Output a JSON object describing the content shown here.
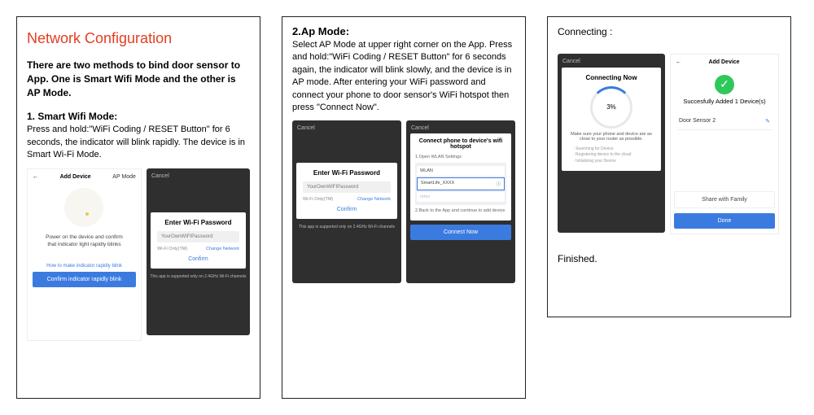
{
  "panel1": {
    "title": "Network Configuration",
    "intro": "There are two methods to bind door sensor to App. One is Smart Wifi Mode and the other is AP Mode.",
    "h": "1. Smart Wifi Mode:",
    "body": "Press and hold:\"WiFi Coding / RESET Button\" for 6 seconds, the indicator will blink rapidly. The device is in Smart Wi-Fi Mode.",
    "phoneA": {
      "back": "←",
      "add": "Add Device",
      "ap": "AP Mode",
      "power": "Power on the device and confirm",
      "blink": "that indicator light rapidly blinks",
      "how": "How to make indicator rapidly blink",
      "confirm": "Confirm indicator rapidly blink"
    },
    "phoneB": {
      "cancel": "Cancel",
      "title": "Enter Wi-Fi Password",
      "input": "YourOwnWIFIPassword",
      "only": "Wi-Fi Only(TM)",
      "change": "Change Network",
      "confirm": "Confirm",
      "note": "This app is supported only on 2.4GHz Wi-Fi channels"
    }
  },
  "panel2": {
    "h": "2.Ap Mode:",
    "body": "Select AP Mode at upper right corner on the App. Press and hold:\"WiFi Coding / RESET Button\" for 6 seconds again, the indicator will blink slowly, and the device is in AP mode. After entering your WiFi password and connect your phone to door sensor's WiFi hotspot then press \"Connect Now\".",
    "phoneA": {
      "cancel": "Cancel",
      "title": "Enter Wi-Fi Password",
      "input": "YourOwnWIFIPassword",
      "only": "Wi-Fi Only(TM)",
      "change": "Change Network",
      "confirm": "Confirm",
      "note": "This app is supported only on 2.4GHz Wi-Fi channels"
    },
    "phoneB": {
      "cancel": "Cancel",
      "title": "Connect phone to device's wifi hotspot",
      "step1": "1.Open WLAN Settings",
      "w1": "WLAN",
      "w2": "SmartLife_XXXX",
      "w3": "other",
      "step2": "2.Back to the App and continue to add device",
      "connect": "Connect Now"
    }
  },
  "panel3": {
    "title": "Connecting :",
    "phoneA": {
      "cancel": "Cancel",
      "title": "Connecting Now",
      "pct": "3%",
      "msg": "Make sure your phone and device are as close to your router as possible.",
      "b1": "· Searching for Device",
      "b2": "· Registering device to the cloud",
      "b3": "· Initializing your Device"
    },
    "phoneB": {
      "back": "←",
      "add": "Add Device",
      "succ": "Succesfully Added 1 Device(s)",
      "dev": "Door Sensor 2",
      "share": "Share with Family",
      "done": "Done"
    },
    "fin": "Finished."
  }
}
